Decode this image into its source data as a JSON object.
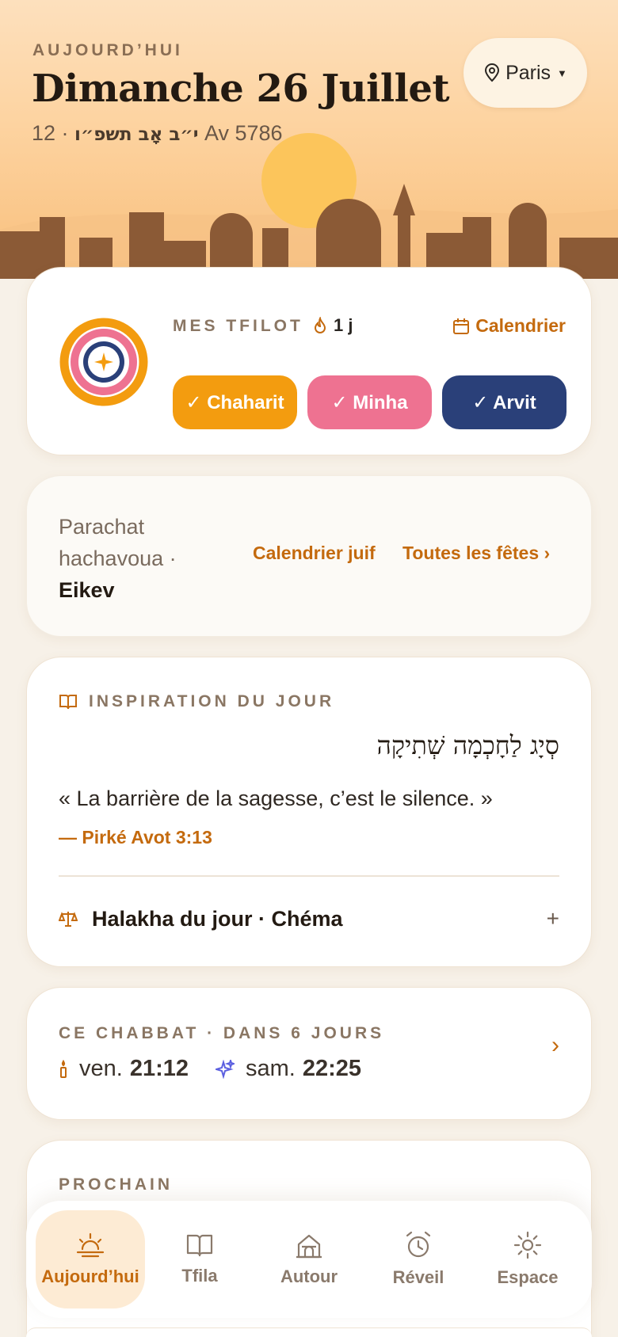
{
  "header": {
    "eyebrow": "AUJOURD’HUI",
    "title": "Dimanche 26 Juillet",
    "hebrew_date": "י״ב אָב תשפ״ו",
    "separator": " · ",
    "date_secondary": "12 Av 5786",
    "city": "Paris"
  },
  "tfilot": {
    "label": "MES TFILOT",
    "streak": "1 j",
    "calendar_link": "Calendrier",
    "prayers": [
      {
        "label": "✓ Chaharit",
        "color": "#f39c0f"
      },
      {
        "label": "✓ Minha",
        "color": "#ee7291"
      },
      {
        "label": "✓ Arvit",
        "color": "#2a4079"
      }
    ]
  },
  "parachat": {
    "prefix": "Parachat hachavoua · ",
    "name": "Eikev",
    "link_calendar": "Calendrier juif",
    "link_feasts": "Toutes les fêtes ›"
  },
  "inspiration": {
    "label": "INSPIRATION DU JOUR",
    "hebrew": "סְיָג לַחָכְמָה שְׁתִיקָה",
    "quote": "« La barrière de la sagesse, c’est le silence. »",
    "source": "— Pirké Avot 3:13",
    "halakha": "Halakha du jour · Chéma",
    "expand": "+"
  },
  "chabbat": {
    "label": "CE CHABBAT · DANS 6 JOURS",
    "entry_day": "ven.",
    "entry_time": "21:12",
    "exit_day": "sam.",
    "exit_time": "22:25",
    "arrow": "›"
  },
  "prochain": {
    "label": "PROCHAIN"
  },
  "nav": {
    "items": [
      {
        "label": "Aujourd’hui",
        "icon": "sunrise-icon"
      },
      {
        "label": "Tfila",
        "icon": "book-icon"
      },
      {
        "label": "Autour",
        "icon": "synagogue-icon"
      },
      {
        "label": "Réveil",
        "icon": "alarm-clock-icon"
      },
      {
        "label": "Espace",
        "icon": "sun-settings-icon"
      }
    ]
  },
  "colors": {
    "accent": "#c46a0e",
    "chaharit": "#f39c0f",
    "minha": "#ee7291",
    "arvit": "#2a4079",
    "skyline": "#8b5a36",
    "background": "#f7f1e8"
  }
}
